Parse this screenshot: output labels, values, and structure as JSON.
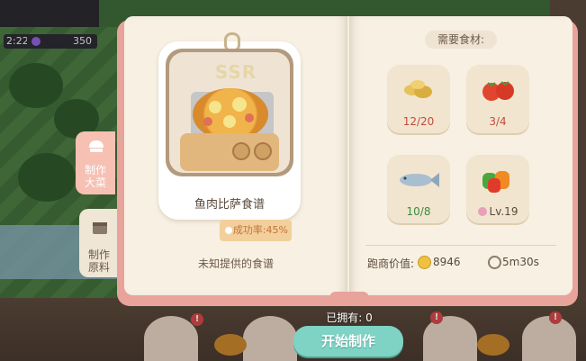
{
  "hud": {
    "time": "2:22",
    "gems": "350"
  },
  "tabs": {
    "make_dish": "制作\n大菜",
    "make_raw": "制作\n原料"
  },
  "recipe": {
    "rarity": "SSR",
    "name": "鱼肉比萨食谱",
    "success_rate": "成功率:45%",
    "note": "未知提供的食谱"
  },
  "ingredients": {
    "title": "需要食材:",
    "items": [
      {
        "icon": "grain-icon",
        "count": "12/20",
        "status": "short"
      },
      {
        "icon": "tomato-icon",
        "count": "3/4",
        "status": "short"
      },
      {
        "icon": "fish-icon",
        "count": "10/8",
        "status": "enough"
      },
      {
        "icon": "pepper-icon",
        "count": "Lv.19",
        "status": "level"
      }
    ]
  },
  "stats": {
    "price_label": "跑商价值:",
    "price": "8946",
    "time": "5m30s"
  },
  "owned": "已拥有: 0",
  "start_button": "开始制作",
  "colors": {
    "start_button": "#7fd3c4",
    "short": "#c14b3c",
    "enough": "#3c8c3c"
  }
}
